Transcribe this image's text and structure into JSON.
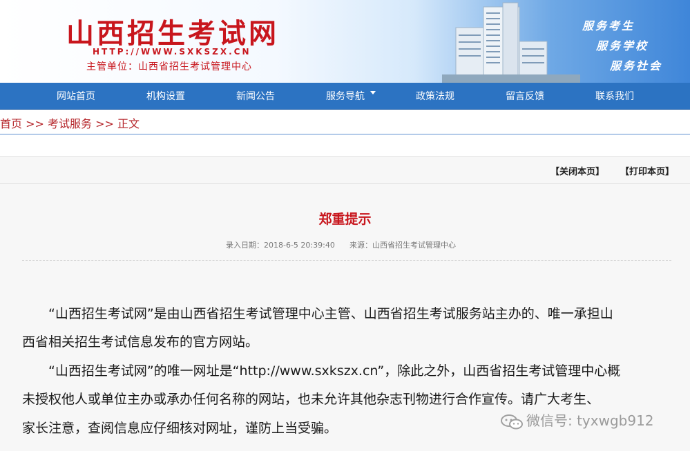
{
  "header": {
    "site_title": "山西招生考试网",
    "site_url": "HTTP://WWW.SXKSZX.CN",
    "supervisor": "主管单位：山西省招生考试管理中心",
    "slogans": [
      "服务考生",
      "服务学校",
      "服务社会"
    ]
  },
  "nav": {
    "items": [
      "网站首页",
      "机构设置",
      "新闻公告",
      "服务导航",
      "政策法规",
      "留言反馈",
      "联系我们"
    ]
  },
  "breadcrumb": {
    "home": "首页",
    "sep1": ">>",
    "section": "考试服务",
    "sep2": ">>",
    "current": "正文"
  },
  "actions": {
    "close": "【关闭本页】",
    "print": "【打印本页】"
  },
  "article": {
    "title": "郑重提示",
    "date": "录入日期：2018-6-5 20:39:40",
    "source": "来源：山西省招生考试管理中心",
    "lines": [
      "“山西招生考试网”是由山西省招生考试管理中心主管、山西省招生考试服务站主办的、唯一承担山",
      "西省相关招生考试信息发布的官方网站。",
      "“山西招生考试网”的唯一网址是“http://www.sxkszx.cn”，除此之外，山西省招生考试管理中心概",
      "未授权他人或单位主办或承办任何名称的网站，也未允许其他杂志刊物进行合作宣传。请广大考生、",
      "家长注意，查阅信息应仔细核对网址，谨防上当受骗。"
    ]
  },
  "watermark": {
    "text": "微信号: tyxwgb912",
    "icon": "wechat-icon"
  },
  "colors": {
    "brand_red": "#c8161d",
    "nav_blue": "#2c73c2",
    "breadcrumb_red": "#b5262b"
  }
}
